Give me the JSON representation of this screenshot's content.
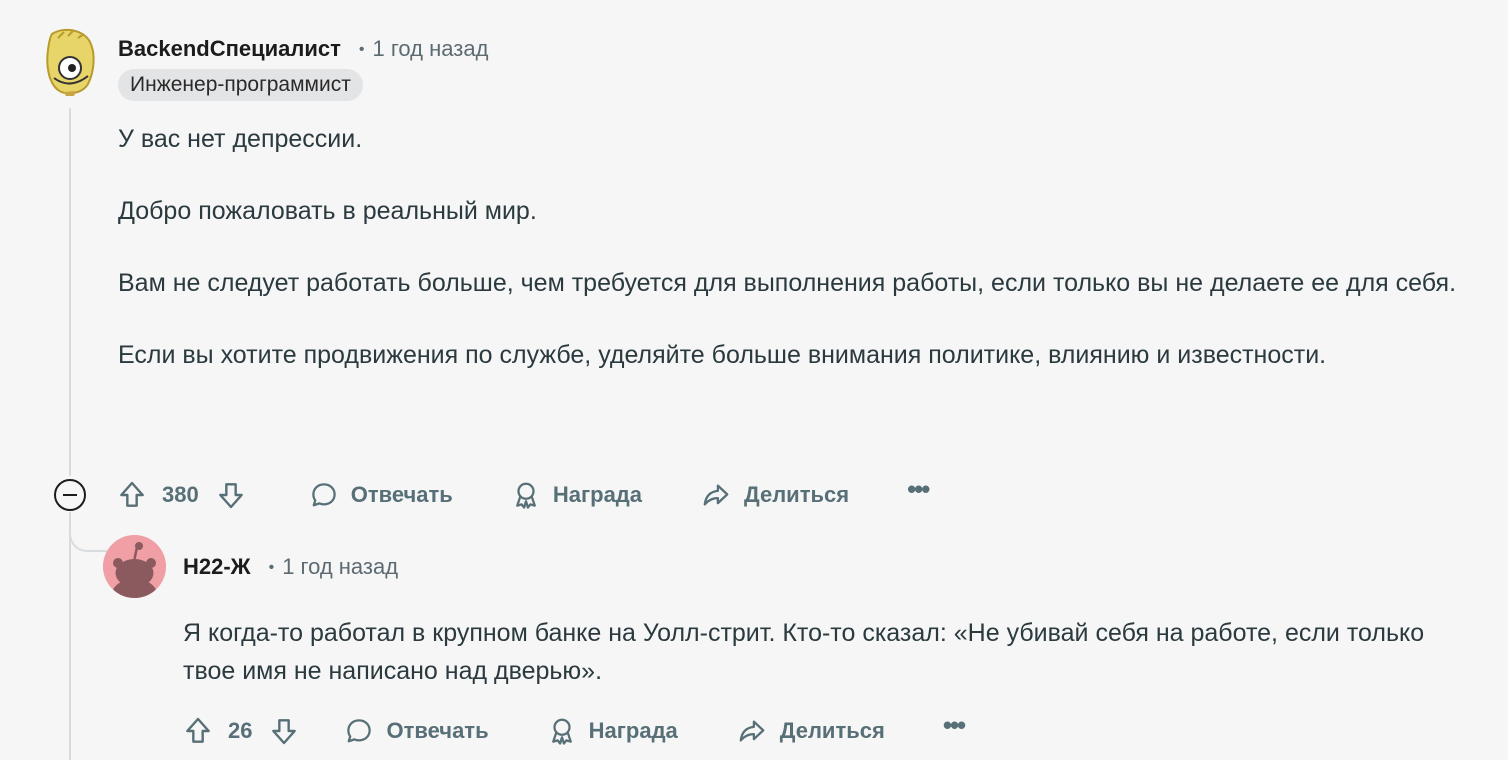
{
  "comments": [
    {
      "author": "BackendСпециалист",
      "time": "1 год назад",
      "flair": "Инженер-программист",
      "paragraphs": [
        "У вас нет депрессии.",
        "Добро пожаловать в реальный мир.",
        "Вам не следует работать больше, чем требуется для выполнения работы, если только вы не делаете ее для себя.",
        "Если вы хотите продвижения по службе, уделяйте больше внимания политике, влиянию и известности."
      ],
      "votes": "380",
      "reply_label": "Отвечать",
      "award_label": "Награда",
      "share_label": "Делиться",
      "more_label": "•••"
    },
    {
      "author": "H22-Ж",
      "time": "1 год назад",
      "paragraphs": [
        "Я когда-то работал в крупном банке на Уолл-стрит. Кто-то сказал: «Не убивай себя на работе, если только твое имя не написано над дверью»."
      ],
      "votes": "26",
      "reply_label": "Отвечать",
      "award_label": "Награда",
      "share_label": "Делиться",
      "more_label": "•••"
    }
  ],
  "icons": {
    "upvote": "arrow-up-icon",
    "downvote": "arrow-down-icon",
    "reply": "speech-bubble-icon",
    "award": "award-ribbon-icon",
    "share": "share-arrow-icon",
    "more": "ellipsis-icon",
    "collapse": "minus-circle-icon"
  },
  "colors": {
    "background": "#f6f6f6",
    "meta_text": "#576f76",
    "flair_bg": "#e3e4e6",
    "reply_avatar_bg": "#f0a0a4",
    "thread_line": "#d9dcdf"
  }
}
